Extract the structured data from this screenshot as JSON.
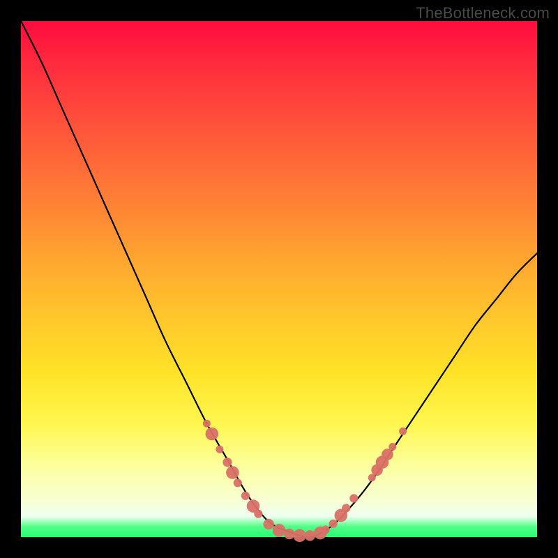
{
  "watermark": "TheBottleneck.com",
  "colors": {
    "page_bg": "#000000",
    "curve": "#000000",
    "marker": "#d97066",
    "gradient_top": "#ff0b3f",
    "gradient_mid": "#ffe228",
    "gradient_bottom": "#24fe73"
  },
  "chart_data": {
    "type": "line",
    "title": "",
    "xlabel": "",
    "ylabel": "",
    "xlim": [
      0,
      100
    ],
    "ylim": [
      0,
      100
    ],
    "grid": false,
    "legend": false,
    "note": "y values are read as percent from the top of the plot area (0 = top, 100 = bottom). Curve descends steeply from upper-left, bottoms out near x≈48–58 (y≈100), then rises to mid-right.",
    "series": [
      {
        "name": "bottleneck-curve",
        "x": [
          0,
          4,
          8,
          12,
          16,
          20,
          24,
          28,
          32,
          36,
          40,
          44,
          48,
          52,
          56,
          60,
          64,
          68,
          72,
          76,
          80,
          84,
          88,
          92,
          96,
          100
        ],
        "y": [
          0,
          8,
          17,
          26,
          35,
          44,
          53,
          62,
          70,
          78,
          85,
          92,
          97,
          99,
          100,
          98,
          94,
          89,
          83,
          77,
          71,
          65,
          59,
          54,
          49,
          45
        ]
      }
    ],
    "markers": {
      "name": "highlight-points",
      "note": "coral dots clustered on both flanks of the valley and along the flat bottom",
      "points": [
        {
          "x": 36.0,
          "y": 78.0,
          "r": 1.0
        },
        {
          "x": 37.0,
          "y": 80.0,
          "r": 1.7
        },
        {
          "x": 38.5,
          "y": 83.0,
          "r": 1.0
        },
        {
          "x": 40.0,
          "y": 85.5,
          "r": 1.2
        },
        {
          "x": 41.0,
          "y": 87.5,
          "r": 1.7
        },
        {
          "x": 42.0,
          "y": 89.5,
          "r": 1.1
        },
        {
          "x": 43.5,
          "y": 92.0,
          "r": 1.1
        },
        {
          "x": 45.0,
          "y": 94.0,
          "r": 1.7
        },
        {
          "x": 46.0,
          "y": 95.5,
          "r": 1.1
        },
        {
          "x": 48.0,
          "y": 97.5,
          "r": 1.4
        },
        {
          "x": 50.0,
          "y": 98.7,
          "r": 1.7
        },
        {
          "x": 52.0,
          "y": 99.4,
          "r": 1.4
        },
        {
          "x": 54.0,
          "y": 99.7,
          "r": 1.7
        },
        {
          "x": 56.0,
          "y": 99.7,
          "r": 1.4
        },
        {
          "x": 58.0,
          "y": 99.2,
          "r": 1.7
        },
        {
          "x": 59.0,
          "y": 98.6,
          "r": 1.1
        },
        {
          "x": 60.5,
          "y": 97.4,
          "r": 1.1
        },
        {
          "x": 62.0,
          "y": 95.8,
          "r": 1.7
        },
        {
          "x": 63.0,
          "y": 94.4,
          "r": 1.1
        },
        {
          "x": 64.5,
          "y": 92.5,
          "r": 1.1
        },
        {
          "x": 68.0,
          "y": 88.5,
          "r": 1.0
        },
        {
          "x": 69.0,
          "y": 87.0,
          "r": 1.5
        },
        {
          "x": 70.0,
          "y": 85.5,
          "r": 1.7
        },
        {
          "x": 71.0,
          "y": 84.0,
          "r": 1.5
        },
        {
          "x": 72.0,
          "y": 82.5,
          "r": 1.0
        },
        {
          "x": 74.0,
          "y": 79.5,
          "r": 1.0
        }
      ]
    }
  }
}
